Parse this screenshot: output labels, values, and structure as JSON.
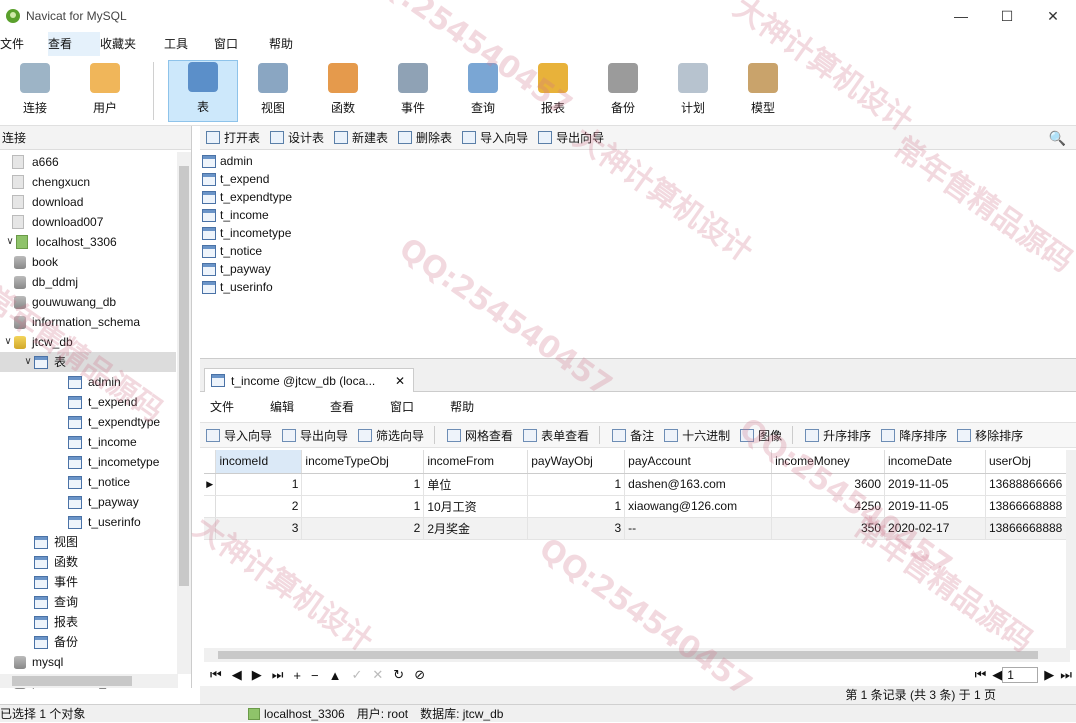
{
  "window": {
    "title": "Navicat for MySQL",
    "min": "—",
    "max": "☐",
    "close": "✕"
  },
  "menu": [
    "文件",
    "查看",
    "收藏夹",
    "工具",
    "窗口",
    "帮助"
  ],
  "toolbar": [
    {
      "label": "连接",
      "icon": "connection-icon",
      "color": "#9db4c6"
    },
    {
      "label": "用户",
      "icon": "user-icon",
      "color": "#f0b65a"
    },
    {
      "label": "表",
      "icon": "table-icon",
      "color": "#5b8fc9"
    },
    {
      "label": "视图",
      "icon": "view-icon",
      "color": "#8aa6c2"
    },
    {
      "label": "函数",
      "icon": "function-icon",
      "color": "#e59a4c"
    },
    {
      "label": "事件",
      "icon": "event-icon",
      "color": "#8fa2b5"
    },
    {
      "label": "查询",
      "icon": "query-icon",
      "color": "#7aa6d4"
    },
    {
      "label": "报表",
      "icon": "report-icon",
      "color": "#e8b23a"
    },
    {
      "label": "备份",
      "icon": "backup-icon",
      "color": "#9b9b9b"
    },
    {
      "label": "计划",
      "icon": "schedule-icon",
      "color": "#b7c3cf"
    },
    {
      "label": "模型",
      "icon": "model-icon",
      "color": "#c9a36b"
    }
  ],
  "left": {
    "header": "连接",
    "tree": [
      {
        "label": "a666",
        "type": "conn",
        "indent": 0
      },
      {
        "label": "chengxucn",
        "type": "conn",
        "indent": 0
      },
      {
        "label": "download",
        "type": "conn",
        "indent": 0
      },
      {
        "label": "download007",
        "type": "conn",
        "indent": 0
      },
      {
        "label": "localhost_3306",
        "type": "server",
        "indent": 0,
        "arrow": "∨"
      },
      {
        "label": "book",
        "type": "db",
        "indent": 1
      },
      {
        "label": "db_ddmj",
        "type": "db",
        "indent": 1
      },
      {
        "label": "gouwuwang_db",
        "type": "db",
        "indent": 1
      },
      {
        "label": "information_schema",
        "type": "db",
        "indent": 1
      },
      {
        "label": "jtcw_db",
        "type": "dbopen",
        "indent": 1,
        "arrow": "∨"
      },
      {
        "label": "表",
        "type": "folder",
        "indent": 2,
        "arrow": "∨",
        "selected": true
      },
      {
        "label": "admin",
        "type": "table",
        "indent": 3
      },
      {
        "label": "t_expend",
        "type": "table",
        "indent": 3
      },
      {
        "label": "t_expendtype",
        "type": "table",
        "indent": 3
      },
      {
        "label": "t_income",
        "type": "table",
        "indent": 3
      },
      {
        "label": "t_incometype",
        "type": "table",
        "indent": 3
      },
      {
        "label": "t_notice",
        "type": "table",
        "indent": 3
      },
      {
        "label": "t_payway",
        "type": "table",
        "indent": 3
      },
      {
        "label": "t_userinfo",
        "type": "table",
        "indent": 3
      },
      {
        "label": "视图",
        "type": "view",
        "indent": 2
      },
      {
        "label": "函数",
        "type": "func",
        "indent": 2
      },
      {
        "label": "事件",
        "type": "event",
        "indent": 2
      },
      {
        "label": "查询",
        "type": "query",
        "indent": 2
      },
      {
        "label": "报表",
        "type": "report",
        "indent": 2
      },
      {
        "label": "备份",
        "type": "backup",
        "indent": 2
      },
      {
        "label": "mysql",
        "type": "db",
        "indent": 1
      },
      {
        "label": "performance_schem",
        "type": "db",
        "indent": 1
      }
    ]
  },
  "objbar": [
    "打开表",
    "设计表",
    "新建表",
    "删除表",
    "导入向导",
    "导出向导"
  ],
  "objects": [
    "admin",
    "t_expend",
    "t_expendtype",
    "t_income",
    "t_incometype",
    "t_notice",
    "t_payway",
    "t_userinfo"
  ],
  "tab": {
    "label": "t_income @jtcw_db (loca...",
    "close": "✕"
  },
  "innermenu": [
    "文件",
    "编辑",
    "查看",
    "窗口",
    "帮助"
  ],
  "innertools": [
    "导入向导",
    "导出向导",
    "筛选向导",
    "网格查看",
    "表单查看",
    "备注",
    "十六进制",
    "图像",
    "升序排序",
    "降序排序",
    "移除排序"
  ],
  "grid": {
    "columns": [
      "incomeId",
      "incomeTypeObj",
      "incomeFrom",
      "payWayObj",
      "payAccount",
      "incomeMoney",
      "incomeDate",
      "userObj"
    ],
    "rows": [
      [
        "1",
        "1",
        "单位",
        "1",
        "dashen@163.com",
        "3600",
        "2019-11-05",
        "13688866666"
      ],
      [
        "2",
        "1",
        "10月工资",
        "1",
        "xiaowang@126.com",
        "4250",
        "2019-11-05",
        "13866668888"
      ],
      [
        "3",
        "2",
        "2月奖金",
        "3",
        "--",
        "350",
        "2020-02-17",
        "13866668888"
      ]
    ]
  },
  "nav": {
    "page": "1"
  },
  "recinfo": "第 1 条记录 (共 3 条) 于 1 页",
  "status": {
    "left": "已选择 1 个对象",
    "conn": "localhost_3306",
    "user": "用户: root",
    "db": "数据库: jtcw_db"
  },
  "watermarks": [
    "大神计算机设计",
    "QQ:254540457",
    "常年售精品源码",
    "大神计算机设计",
    "QQ:254540457",
    "常年售精品源码",
    "QQ:254540457",
    "大神计算机设计",
    "常年售精品源码",
    "QQ:254540457"
  ]
}
